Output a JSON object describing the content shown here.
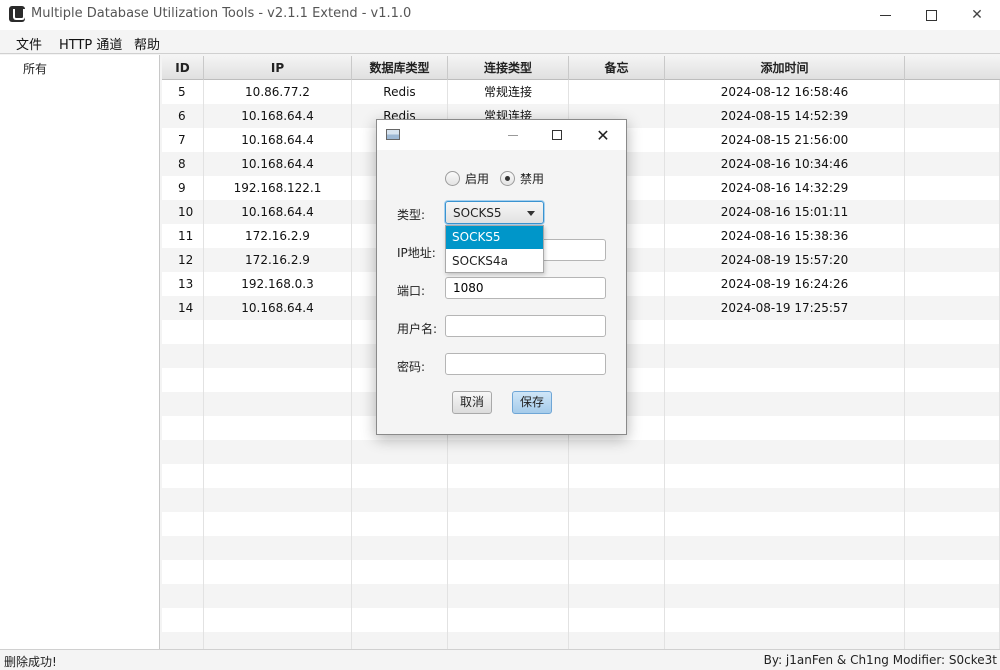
{
  "window": {
    "title": "Multiple Database Utilization Tools - v2.1.1 Extend - v1.1.0",
    "minimize": "—",
    "maximize": "□",
    "close": "✕"
  },
  "menu": [
    "文件",
    "HTTP 通道",
    "帮助"
  ],
  "sidebar": {
    "items": [
      "所有"
    ]
  },
  "table": {
    "columns": [
      "ID",
      "IP",
      "数据库类型",
      "连接类型",
      "备忘",
      "添加时间"
    ],
    "rows": [
      [
        "5",
        "10.86.77.2",
        "Redis",
        "常规连接",
        "",
        "2024-08-12 16:58:46"
      ],
      [
        "6",
        "10.168.64.4",
        "Redis",
        "常规连接",
        "",
        "2024-08-15 14:52:39"
      ],
      [
        "7",
        "10.168.64.4",
        "",
        "",
        "",
        "2024-08-15 21:56:00"
      ],
      [
        "8",
        "10.168.64.4",
        "",
        "",
        "",
        "2024-08-16 10:34:46"
      ],
      [
        "9",
        "192.168.122.1",
        "",
        "",
        "",
        "2024-08-16 14:32:29"
      ],
      [
        "10",
        "10.168.64.4",
        "",
        "",
        "",
        "2024-08-16 15:01:11"
      ],
      [
        "11",
        "172.16.2.9",
        "P",
        "",
        "",
        "2024-08-16 15:38:36"
      ],
      [
        "12",
        "172.16.2.9",
        "",
        "",
        "",
        "2024-08-19 15:57:20"
      ],
      [
        "13",
        "192.168.0.3",
        "",
        "",
        "",
        "2024-08-19 16:24:26"
      ],
      [
        "14",
        "10.168.64.4",
        "P",
        "",
        "",
        "2024-08-19 17:25:57"
      ]
    ]
  },
  "status": {
    "left": "删除成功!",
    "right": "By: j1anFen & Ch1ng Modifier: S0cke3t"
  },
  "dialog": {
    "radio_enable": "启用",
    "radio_disable": "禁用",
    "selected_radio": "禁用",
    "type_label": "类型:",
    "type_value": "SOCKS5",
    "type_options": [
      "SOCKS5",
      "SOCKS4a"
    ],
    "ip_label": "IP地址:",
    "ip_value": "",
    "port_label": "端口:",
    "port_value": "1080",
    "user_label": "用户名:",
    "user_value": "",
    "pass_label": "密码:",
    "pass_value": "",
    "cancel_label": "取消",
    "save_label": "保存",
    "close": "✕"
  },
  "colors": {
    "selection": "#0096c9",
    "focus": "#3a93d0"
  }
}
